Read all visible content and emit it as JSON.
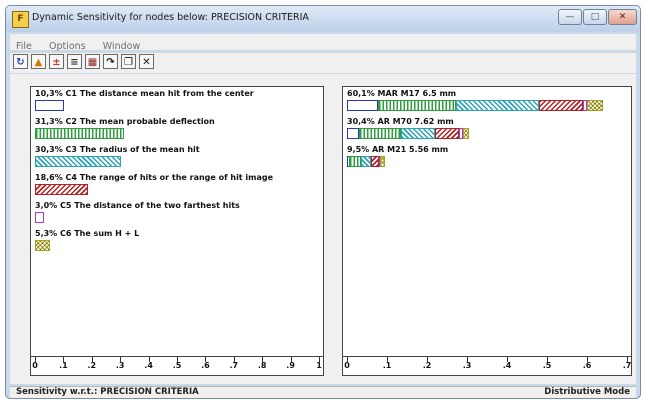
{
  "window": {
    "title": "Dynamic Sensitivity for nodes below: PRECISION CRITERIA",
    "min_glyph": "—",
    "max_glyph": "□",
    "close_glyph": "✕",
    "app_icon": "F"
  },
  "menu": [
    {
      "label": "File"
    },
    {
      "label": "Options"
    },
    {
      "label": "Window"
    }
  ],
  "toolbar": [
    {
      "name": "refresh-icon",
      "glyph": "↻",
      "color": "#1f3fbf"
    },
    {
      "name": "bar-chart-icon",
      "glyph": "▲",
      "color": "#d07a00"
    },
    {
      "name": "plus-chart-icon",
      "glyph": "±",
      "color": "#c0392b"
    },
    {
      "name": "sort-icon",
      "glyph": "≡",
      "color": "#333333"
    },
    {
      "name": "gradient-icon",
      "glyph": "▦",
      "color": "#8b1a1a"
    },
    {
      "name": "redo-icon",
      "glyph": "↷",
      "color": "#111111"
    },
    {
      "name": "windows-icon",
      "glyph": "❐",
      "color": "#111111"
    },
    {
      "name": "close-icon",
      "glyph": "✕",
      "color": "#111111"
    }
  ],
  "colors": {
    "C1": "#2b35c4",
    "C2": "#2e9e3e",
    "C3": "#2aa5b8",
    "C4": "#b22222",
    "C5": "#a53ad1",
    "C6": "#a8a020"
  },
  "chart_data": [
    {
      "type": "bar",
      "panel": "left",
      "xlim": [
        0,
        1
      ],
      "xticks": [
        "0",
        ".1",
        ".2",
        ".3",
        ".4",
        ".5",
        ".6",
        ".7",
        ".8",
        ".9",
        "1"
      ],
      "series": [
        {
          "key": "C1",
          "label": "10,3% C1 The distance mean hit from the center",
          "value": 0.103
        },
        {
          "key": "C2",
          "label": "31,3% C2 The mean probable deflection",
          "value": 0.313
        },
        {
          "key": "C3",
          "label": "30,3% C3 The radius of the mean hit",
          "value": 0.303
        },
        {
          "key": "C4",
          "label": "18,6% C4 The range of hits or the range of hit image",
          "value": 0.186
        },
        {
          "key": "C5",
          "label": "3,0% C5 The distance of the two farthest hits",
          "value": 0.03
        },
        {
          "key": "C6",
          "label": "5,3% C6 The sum H + L",
          "value": 0.053
        }
      ]
    },
    {
      "type": "bar",
      "stacked": true,
      "panel": "right",
      "xlim": [
        0,
        0.7
      ],
      "xticks": [
        "0",
        ".1",
        ".2",
        ".3",
        ".4",
        ".5",
        ".6",
        ".7"
      ],
      "categories": [
        {
          "label": "60,1% MAR M17 6.5 mm",
          "total": 0.601,
          "segments": [
            {
              "key": "C1",
              "value": 0.077
            },
            {
              "key": "C2",
              "value": 0.195
            },
            {
              "key": "C3",
              "value": 0.207
            },
            {
              "key": "C4",
              "value": 0.111
            },
            {
              "key": "C5",
              "value": 0.011
            },
            {
              "key": "C6",
              "value": 0.04
            }
          ]
        },
        {
          "label": "30,4% AR M70 7.62 mm",
          "total": 0.304,
          "segments": [
            {
              "key": "C1",
              "value": 0.03
            },
            {
              "key": "C2",
              "value": 0.105
            },
            {
              "key": "C3",
              "value": 0.085
            },
            {
              "key": "C4",
              "value": 0.06
            },
            {
              "key": "C5",
              "value": 0.009
            },
            {
              "key": "C6",
              "value": 0.015
            }
          ]
        },
        {
          "label": "9,5% AR M21 5.56 mm",
          "total": 0.095,
          "segments": [
            {
              "key": "C1",
              "value": 0.005
            },
            {
              "key": "C2",
              "value": 0.03
            },
            {
              "key": "C3",
              "value": 0.025
            },
            {
              "key": "C4",
              "value": 0.02
            },
            {
              "key": "C5",
              "value": 0.003
            },
            {
              "key": "C6",
              "value": 0.012
            }
          ]
        }
      ]
    }
  ],
  "status": {
    "left": "Sensitivity w.r.t.: PRECISION CRITERIA",
    "right": "Distributive Mode"
  }
}
